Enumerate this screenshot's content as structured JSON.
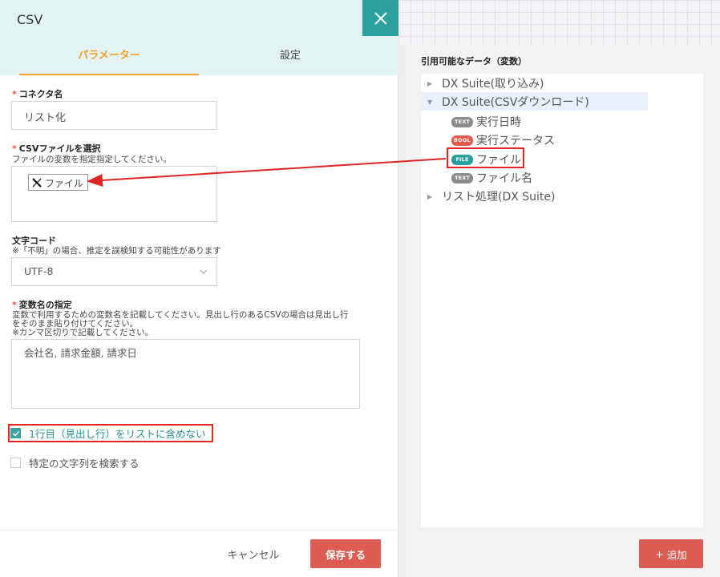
{
  "dialog": {
    "title": "CSV",
    "tabs": [
      {
        "label": "パラメーター",
        "active": true
      },
      {
        "label": "設定",
        "active": false
      }
    ]
  },
  "form": {
    "required_mark": "*",
    "connector_name": {
      "label": "コネクタ名",
      "value": "リスト化"
    },
    "csv_file": {
      "label": "CSVファイルを選択",
      "hint": "ファイルの変数を指定指定してください。",
      "chip_label": "ファイル"
    },
    "encoding": {
      "label": "文字コード",
      "hint": "※「不明」の場合、推定を誤検知する可能性があります",
      "value": "UTF-8"
    },
    "variable_names": {
      "label": "変数名の指定",
      "hint_line1": "変数で利用するための変数名を記載してください。見出し行のあるCSVの場合は見出し行",
      "hint_line2": "をそのまま貼り付けてください。",
      "hint_line3": "※カンマ区切りで記載してください。",
      "value": "会社名, 請求金額, 請求日"
    },
    "skip_header": {
      "label": "1行目（見出し行）をリストに含めない",
      "checked": true
    },
    "search_string": {
      "label": "特定の文字列を検索する",
      "checked": false
    }
  },
  "footer": {
    "cancel_label": "キャンセル",
    "save_label": "保存する"
  },
  "right_panel": {
    "title": "引用可能なデータ（変数）",
    "tree": [
      {
        "label": "DX Suite(取り込み)",
        "expanded": false
      },
      {
        "label": "DX Suite(CSVダウンロード)",
        "expanded": true,
        "selected": true
      },
      {
        "badge": "TEXT",
        "label": "実行日時"
      },
      {
        "badge": "BOOL",
        "label": "実行ステータス"
      },
      {
        "badge": "FILE",
        "label": "ファイル"
      },
      {
        "badge": "TEXT",
        "label": "ファイル名"
      },
      {
        "label": "リスト処理(DX Suite)",
        "expanded": false
      }
    ],
    "add_label": "追加",
    "add_icon": "+"
  },
  "colors": {
    "accent_teal": "#2aa19c",
    "tab_active": "#f0a12b",
    "button_red": "#dc5c54",
    "annotation_red": "#e02424",
    "badge_text": "#8c8c8c",
    "badge_bool": "#e35a4f",
    "badge_file": "#2aa19c"
  },
  "icons": {
    "close": "close-icon",
    "dropdown": "chevron-down-icon",
    "checkbox": "check-icon",
    "file_chip": "x-logo-icon",
    "tree_collapsed": "caret-right-icon",
    "tree_expanded": "caret-down-icon"
  }
}
